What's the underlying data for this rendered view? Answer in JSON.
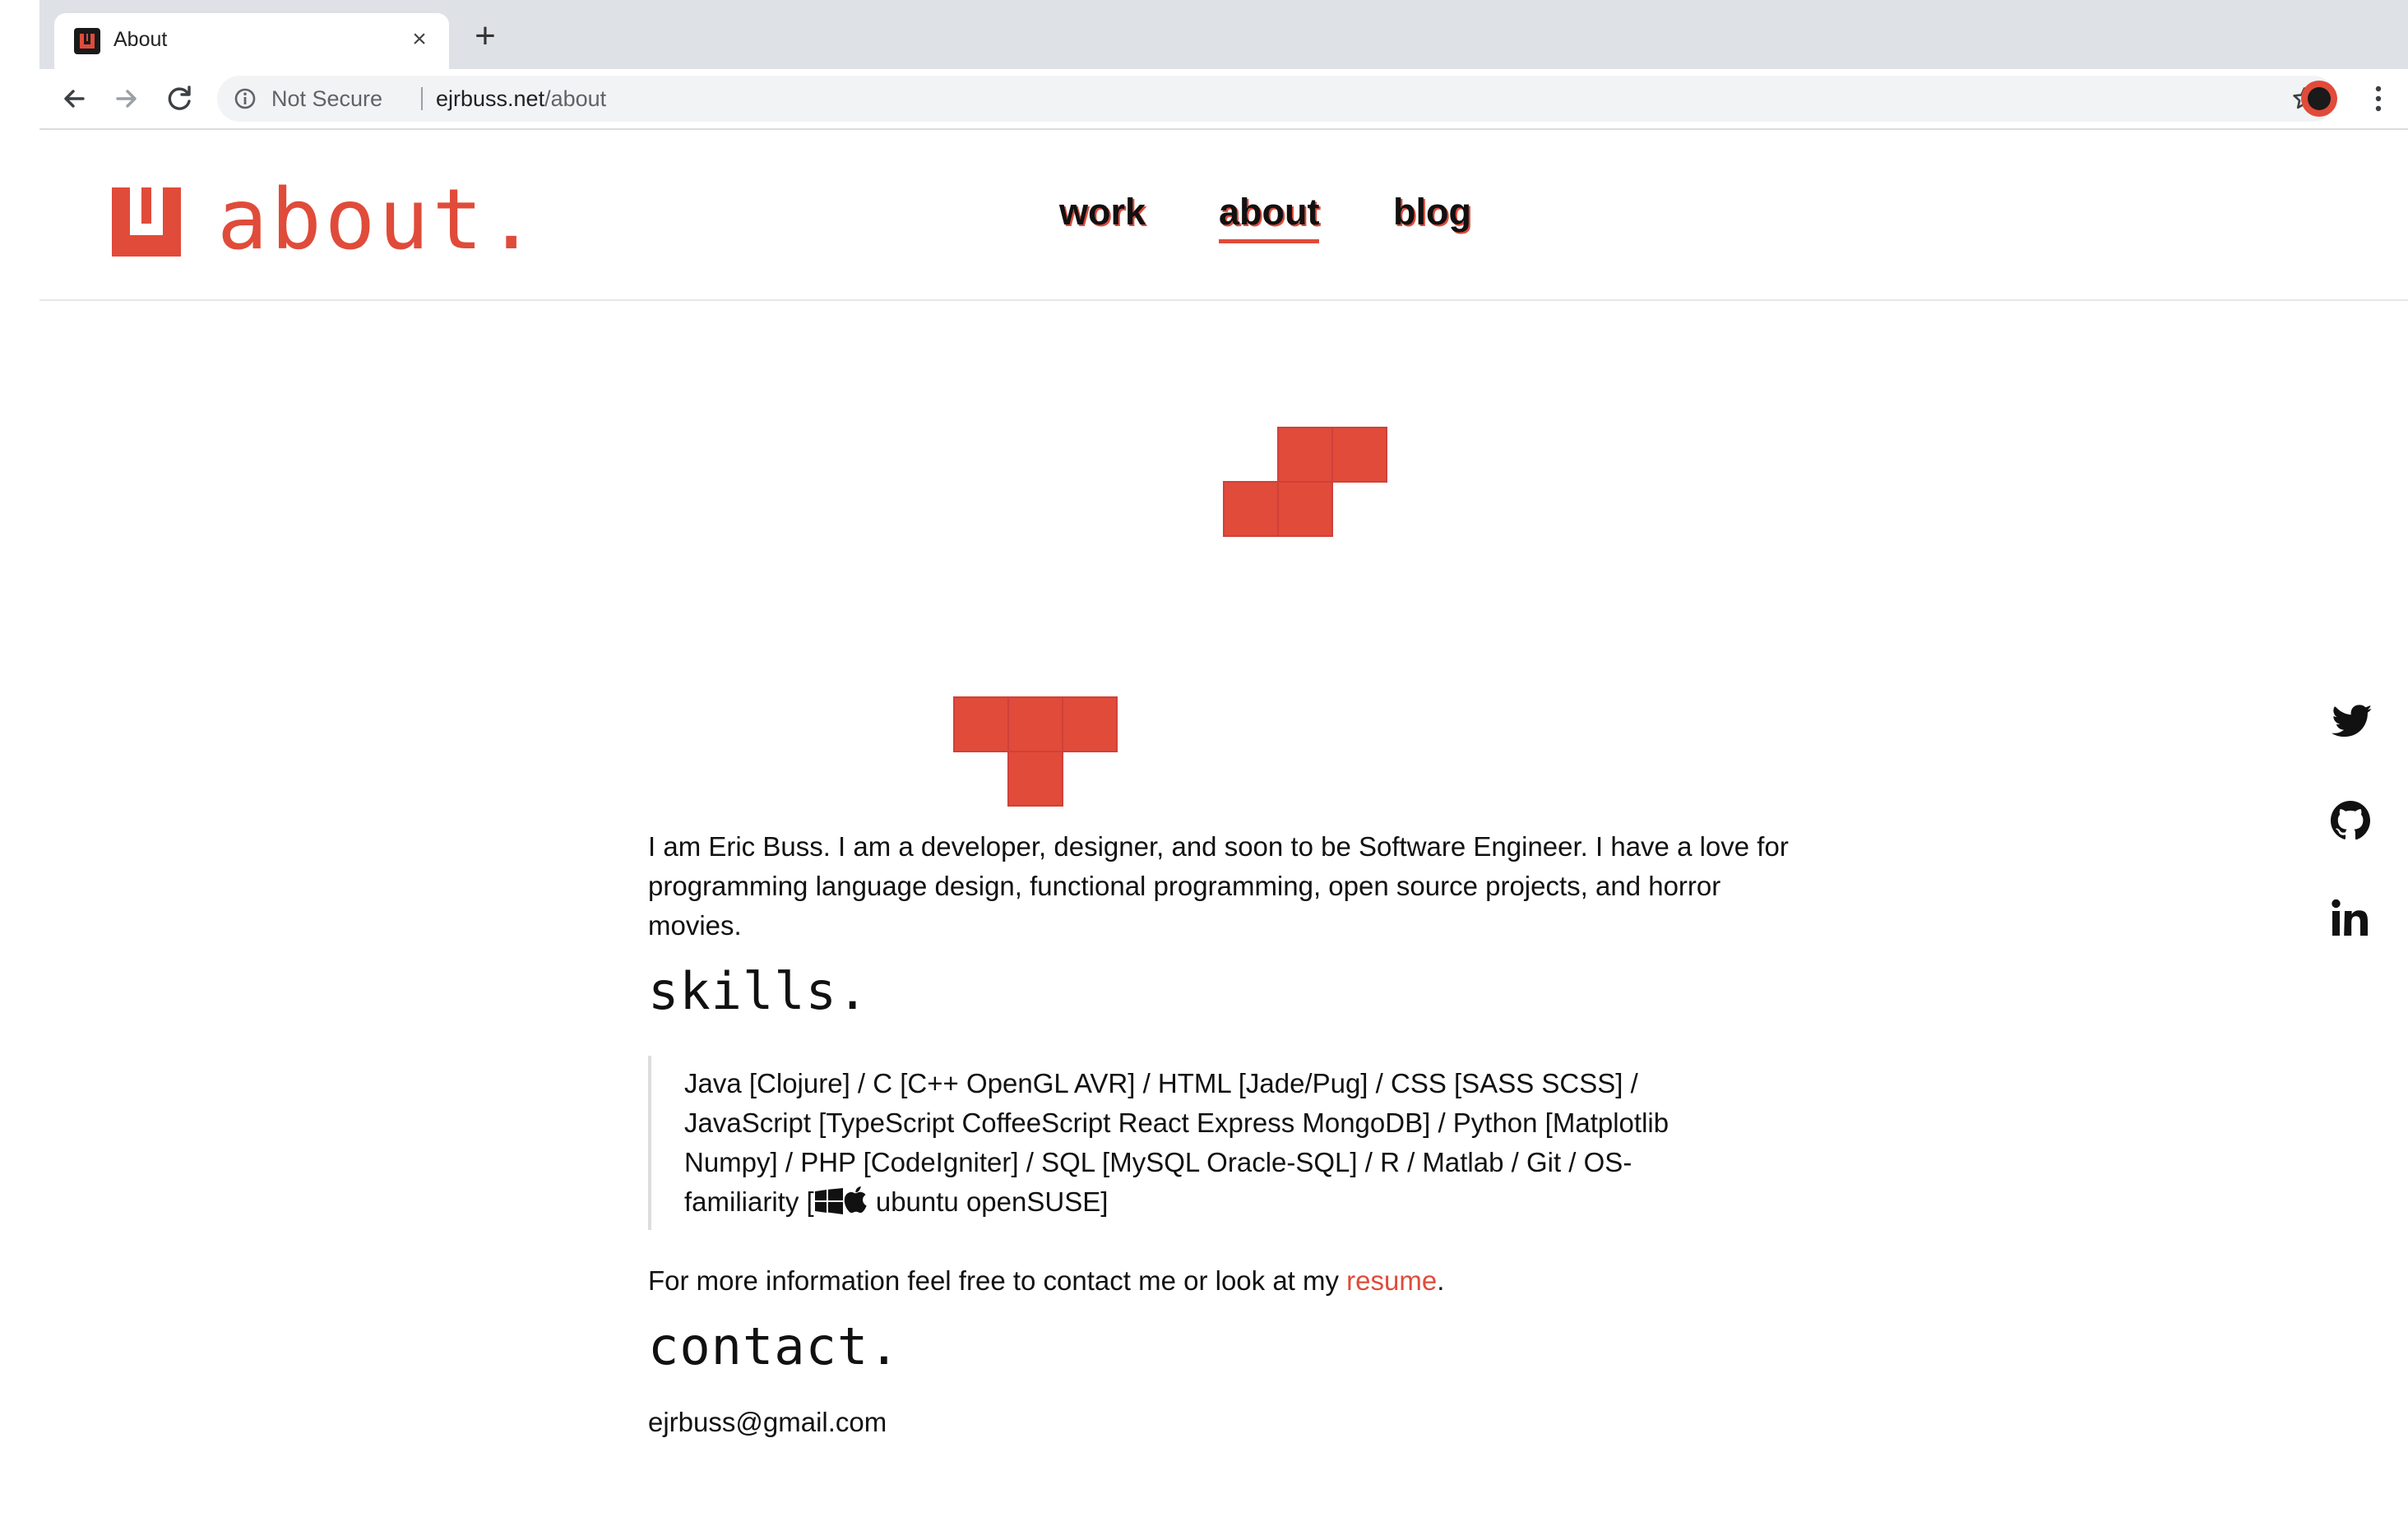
{
  "browser": {
    "tab_title": "About",
    "tab_close": "×",
    "new_tab": "+",
    "security_label": "Not Secure",
    "url_host": "ejrbuss.net",
    "url_path": "/about",
    "icons": [
      "back-arrow-icon",
      "forward-arrow-icon",
      "reload-icon",
      "info-icon",
      "star-icon",
      "profile-avatar",
      "menu-dots-icon"
    ]
  },
  "header": {
    "logo_text": "about.",
    "nav": [
      {
        "label": "work",
        "active": false
      },
      {
        "label": "about",
        "active": true
      },
      {
        "label": "blog",
        "active": false
      }
    ]
  },
  "social": {
    "icons": [
      "twitter-icon",
      "github-icon",
      "linkedin-icon"
    ]
  },
  "content": {
    "intro": "I am Eric Buss. I am a developer, designer, and soon to be Software Engineer. I have a love for programming language design, functional programming, open source projects, and horror movies.",
    "skills_heading": "skills.",
    "skills_text": "Java [Clojure] / C [C++ OpenGL AVR] / HTML [Jade/Pug] / CSS [SASS SCSS] / JavaScript [TypeScript CoffeeScript React Express MongoDB] / Python [Matplotlib Numpy] / PHP [CodeIgniter] / SQL [MySQL Oracle-SQL] / R / Matlab / Git / OS-familiarity [",
    "skills_os_tail": " ubuntu openSUSE]",
    "more_prefix": "For more information feel free to contact me or look at my ",
    "resume_label": "resume",
    "more_suffix": ".",
    "contact_heading": "contact.",
    "email": "ejrbuss@gmail.com"
  },
  "colors": {
    "accent": "#e04b3a",
    "text": "#111111",
    "chrome_bg": "#dee1e6"
  }
}
